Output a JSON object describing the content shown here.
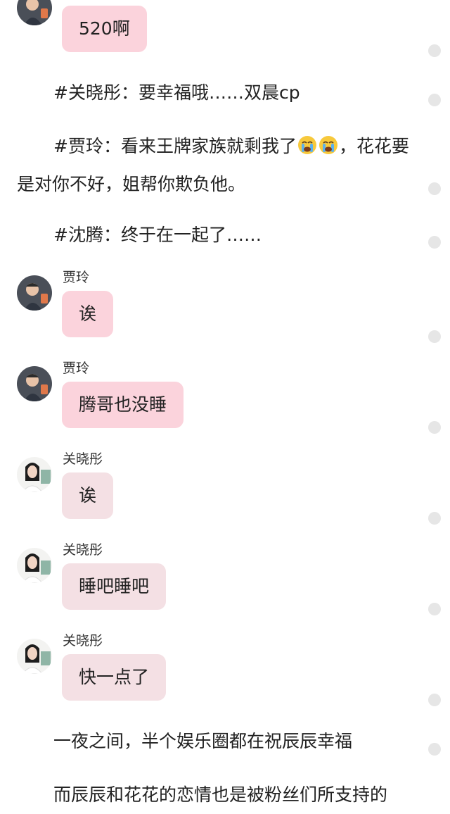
{
  "top_message": {
    "text": "520啊"
  },
  "paragraphs": {
    "p1": "#关晓彤：要幸福哦……双晨cp",
    "p2_before": "#贾玲：看来王牌家族就剩我了",
    "p2_after": "，花花要是对你不好，姐帮你欺负他。",
    "p3": "#沈腾：终于在一起了……",
    "p4": "一夜之间，半个娱乐圈都在祝辰辰幸福",
    "p5": "而辰辰和花花的恋情也是被粉丝们所支持的"
  },
  "emoji": {
    "name": "crying-face-icon"
  },
  "messages": [
    {
      "sender": "贾玲",
      "text": "诶"
    },
    {
      "sender": "贾玲",
      "text": "腾哥也没睡"
    },
    {
      "sender": "关晓彤",
      "text": "诶"
    },
    {
      "sender": "关晓彤",
      "text": "睡吧睡吧"
    },
    {
      "sender": "关晓彤",
      "text": "快一点了"
    }
  ],
  "colors": {
    "bubble_pink": "#fbd3dc",
    "bubble_light": "#f4e0e4",
    "scroll_dot": "#e6e6e6"
  }
}
